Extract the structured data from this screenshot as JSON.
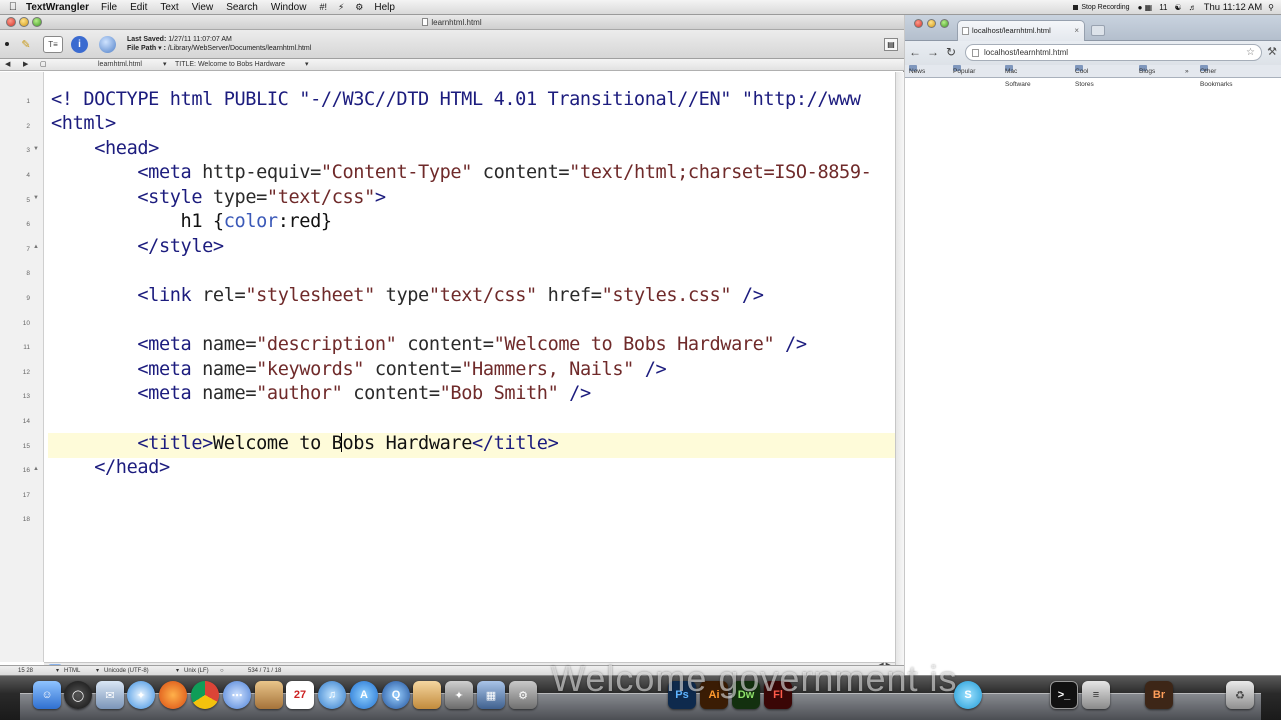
{
  "menubar": {
    "app_name": "TextWrangler",
    "menus": [
      "File",
      "Edit",
      "Text",
      "View",
      "Search",
      "Window",
      "#!",
      "Help"
    ],
    "stop_recording": "Stop Recording",
    "status_number": "11",
    "clock": "Thu 11:12 AM"
  },
  "editor_window": {
    "title": "learnhtml.html",
    "last_saved_label": "Last Saved:",
    "last_saved_value": "1/27/11 11:07:07 AM",
    "file_path_label": "File Path ▾ :",
    "file_path_value": "/Library/WebServer/Documents/learnhtml.html",
    "nav_filename": "learnhtml.html",
    "nav_function": "TITLE: Welcome to Bobs Hardware",
    "line_numbers": [
      "1",
      "2",
      "3",
      "4",
      "5",
      "6",
      "7",
      "8",
      "9",
      "10",
      "11",
      "12",
      "13",
      "14",
      "15",
      "16",
      "17",
      "18"
    ],
    "code": {
      "l1": "<! DOCTYPE html PUBLIC \"-//W3C//DTD HTML 4.01 Transitional//EN\" \"http://www",
      "l2": "<html>",
      "l3": "<head>",
      "l4_tag": "<meta",
      "l4_attr1": " http-equiv=",
      "l4_val1": "\"Content-Type\"",
      "l4_attr2": " content=",
      "l4_val2": "\"text/html;charset=ISO-8859-",
      "l5_tag": "<style",
      "l5_attr": " type=",
      "l5_val": "\"text/css\"",
      "l5_end": ">",
      "l6_sel": "h1 {",
      "l6_prop": "color",
      "l6_rest": ":red}",
      "l7": "</style>",
      "l9_tag": "<link",
      "l9_attr1": " rel=",
      "l9_val1": "\"stylesheet\"",
      "l9_attr2": " type",
      "l9_val2": "\"text/css\"",
      "l9_attr3": " href=",
      "l9_val3": "\"styles.css\"",
      "l9_end": " />",
      "l11_tag": "<meta",
      "l11_attr1": " name=",
      "l11_val1": "\"description\"",
      "l11_attr2": " content=",
      "l11_val2": "\"Welcome to Bobs Hardware\"",
      "l11_end": " />",
      "l12_tag": "<meta",
      "l12_attr1": " name=",
      "l12_val1": "\"keywords\"",
      "l12_attr2": " content=",
      "l12_val2": "\"Hammers, Nails\"",
      "l12_end": " />",
      "l13_tag": "<meta",
      "l13_attr1": " name=",
      "l13_val1": "\"author\"",
      "l13_attr2": " content=",
      "l13_val2": "\"Bob Smith\"",
      "l13_end": " />",
      "l15_open": "<title>",
      "l15_text_a": "Welcome to B",
      "l15_text_b": "obs Hardware",
      "l15_close": "</title>",
      "l16": "</head>"
    },
    "status": {
      "position": "15  28",
      "language": "HTML",
      "encoding": "Unicode (UTF-8)",
      "line_endings": "Unix (LF)",
      "counts": "534 / 71 / 18"
    }
  },
  "browser_window": {
    "tab_title": "localhost/learnhtml.html",
    "url": "localhost/learnhtml.html",
    "bookmarks": [
      "News",
      "Popular",
      "Mac Software",
      "Cool Stores",
      "Blogs",
      "Other Bookmarks"
    ]
  },
  "dock": {
    "icons": [
      "finder-icon",
      "dashboard-icon",
      "mail-icon",
      "safari-icon",
      "firefox-icon",
      "chrome-icon",
      "ichat-icon",
      "address-book-icon",
      "ical-icon",
      "itunes-icon",
      "app-store-icon",
      "quicktime-icon",
      "preview-icon",
      "automator-icon",
      "expose-icon",
      "system-preferences-icon",
      "photoshop-icon",
      "illustrator-icon",
      "dreamweaver-icon",
      "flash-icon",
      "skype-icon",
      "terminal-icon",
      "calculator-icon",
      "trash-icon"
    ],
    "labels": {
      "ps": "Ps",
      "ai": "Ai",
      "dw": "Dw",
      "fl": "Fl",
      "br": "Br"
    },
    "watermark": "Welcome government is"
  },
  "colors": {
    "current_line": "#fefbd9",
    "tag": "#1c1c7e",
    "string": "#6f2a2a",
    "css_keyword": "#3b59b8"
  }
}
